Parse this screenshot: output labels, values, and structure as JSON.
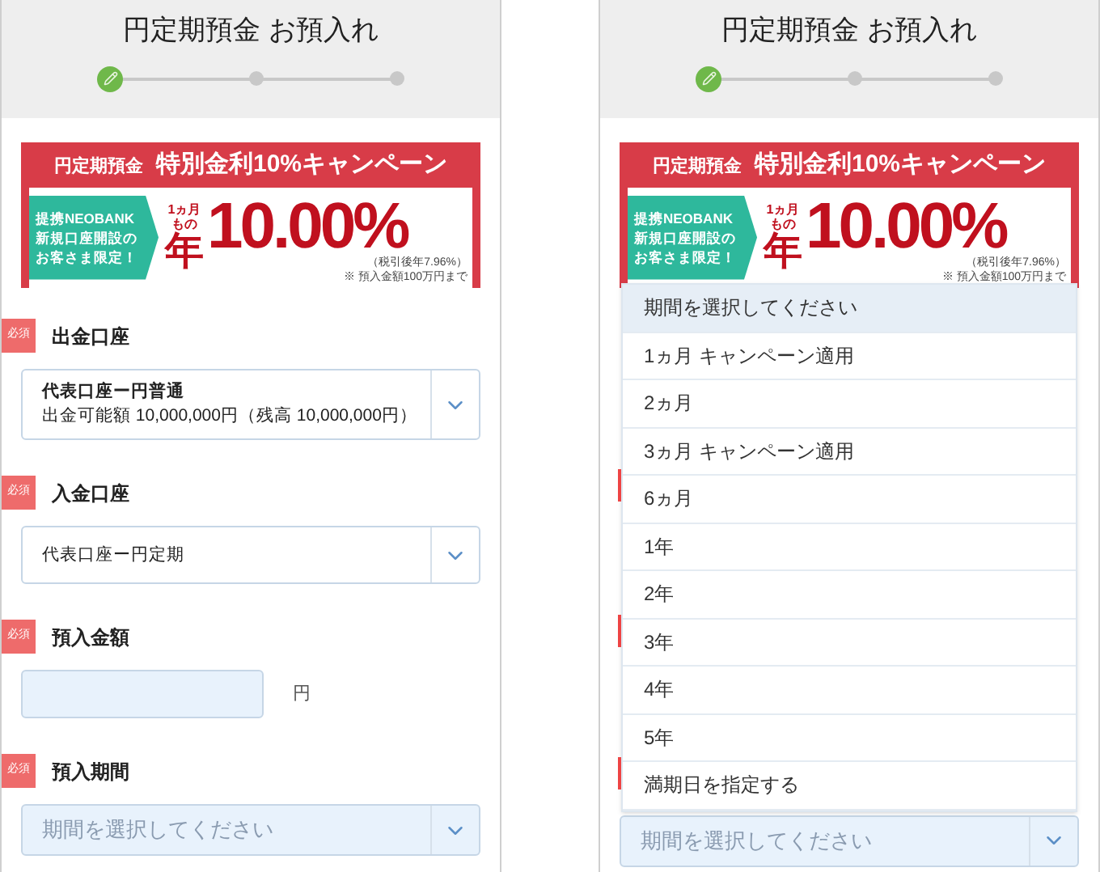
{
  "screens": [
    {
      "header": {
        "title": "円定期預金 お預入れ",
        "steps": [
          {
            "current": true
          },
          {
            "current": false
          },
          {
            "current": false
          }
        ]
      },
      "banner": {
        "product": "円定期預金",
        "headline": "特別金利10%キャンペーン",
        "target": [
          "提携NEOBANK",
          "新規口座開設の",
          "お客さま限定！"
        ],
        "term": [
          "1ヵ月",
          "もの"
        ],
        "year": "年",
        "rate": "10.00%",
        "after_tax": "（税引後年7.96%）",
        "note": "※ 預入金額100万円まで"
      },
      "fields": [
        {
          "kind": "select",
          "badge": "必須",
          "label": "出金口座",
          "lines": [
            "代表口座ー円普通",
            "出金可能額 10,000,000円（残高 10,000,000円）"
          ]
        },
        {
          "kind": "select",
          "badge": "必須",
          "label": "入金口座",
          "lines": [
            "代表口座ー円定期"
          ]
        },
        {
          "kind": "amount",
          "badge": "必須",
          "label": "預入金額",
          "unit": "円"
        },
        {
          "kind": "select",
          "badge": "必須",
          "label": "預入期間",
          "placeholder": "期間を選択してください"
        }
      ]
    },
    {
      "header": {
        "title": "円定期預金 お預入れ",
        "steps": [
          {
            "current": true
          },
          {
            "current": false
          },
          {
            "current": false
          }
        ]
      },
      "banner": {
        "product": "円定期預金",
        "headline": "特別金利10%キャンペーン",
        "target": [
          "提携NEOBANK",
          "新規口座開設の",
          "お客さま限定！"
        ],
        "term": [
          "1ヵ月",
          "もの"
        ],
        "year": "年",
        "rate": "10.00%",
        "after_tax": "（税引後年7.96%）",
        "note": "※ 預入金額100万円まで"
      },
      "dropdown": [
        {
          "label": "期間を選択してください",
          "selected": true
        },
        {
          "label": "1ヵ月 キャンペーン適用",
          "selected": false
        },
        {
          "label": "2ヵ月",
          "selected": false
        },
        {
          "label": "3ヵ月 キャンペーン適用",
          "selected": false
        },
        {
          "label": "6ヵ月",
          "selected": false
        },
        {
          "label": "1年",
          "selected": false
        },
        {
          "label": "2年",
          "selected": false
        },
        {
          "label": "3年",
          "selected": false
        },
        {
          "label": "4年",
          "selected": false
        },
        {
          "label": "5年",
          "selected": false
        },
        {
          "label": "満期日を指定する",
          "selected": false
        }
      ],
      "fields": [
        {
          "kind": "select",
          "placeholder": "期間を選択してください"
        }
      ]
    }
  ]
}
